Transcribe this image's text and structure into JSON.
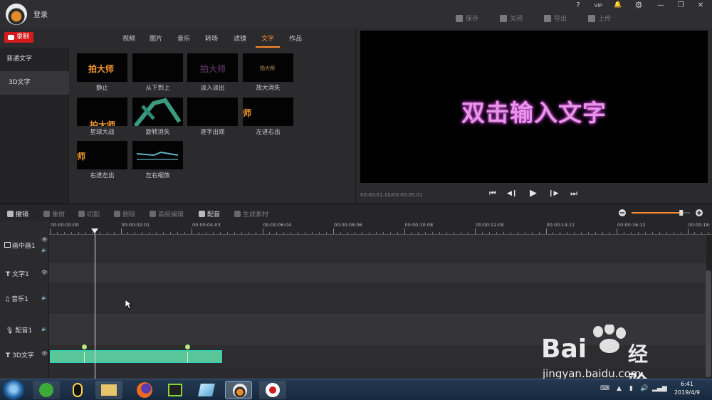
{
  "titlebar": {
    "login": "登录",
    "window_controls": [
      "?",
      "VIP",
      "🔔",
      "⚙",
      "—",
      "❐",
      "✕"
    ],
    "actions": [
      "保存",
      "关闭",
      "导出",
      "上传"
    ]
  },
  "media_panel": {
    "record_label": "录制",
    "tabs": [
      "视频",
      "图片",
      "音乐",
      "转场",
      "滤镜",
      "文字",
      "作品"
    ],
    "active_tab": "文字",
    "side_items": [
      "普通文字",
      "3D文字"
    ],
    "thumbnails": [
      {
        "label": "静止",
        "text": "拍大师"
      },
      {
        "label": "从下到上",
        "text": ""
      },
      {
        "label": "淡入淡出",
        "text": "拍大师"
      },
      {
        "label": "放大消失",
        "text": "拍大师"
      },
      {
        "label": "星球大战",
        "text": "拍大师"
      },
      {
        "label": "旋转消失",
        "text": ""
      },
      {
        "label": "逐字出现",
        "text": ""
      },
      {
        "label": "左进右出",
        "text": "师"
      },
      {
        "label": "右进左出",
        "text": "师"
      },
      {
        "label": "左右缩放",
        "text": ""
      }
    ]
  },
  "preview": {
    "text": "双击输入文字",
    "timecode": "00:00:01.10/00:00:05.01",
    "controls": [
      "⏮",
      "◀❙",
      "▶",
      "❙▶",
      "⏭"
    ]
  },
  "toolbar": {
    "tools": [
      "撤销",
      "重做",
      "切割",
      "删除",
      "高级编辑",
      "配音",
      "生成素材"
    ]
  },
  "timeline": {
    "ticks": [
      "00:00:00:00",
      "00:00:02:01",
      "00:00:04:03",
      "00:00:06:04",
      "00:00:08:06",
      "00:00:10:08",
      "00:00:12:09",
      "00:00:14:11",
      "00:00:16:12",
      "00:00:18:"
    ],
    "tracks": [
      "画中画1",
      "文字1",
      "音乐1",
      "配音1",
      "3D文字"
    ],
    "zoom_level": 0.85
  },
  "taskbar": {
    "time": "6:41",
    "date": "2019/4/9"
  },
  "watermark": {
    "brand": "Bai",
    "brand2": "经验",
    "url": "jingyan.baidu.com"
  },
  "colors": {
    "accent": "#ff8a2a",
    "record": "#d21c1c",
    "clip": "#5ac79a",
    "preview_text": "#e895e7"
  }
}
